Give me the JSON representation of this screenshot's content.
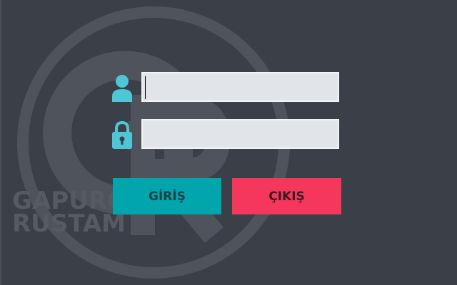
{
  "brand": {
    "line1": "GAPURO",
    "line2": "RUSTAM"
  },
  "login_form": {
    "username_value": "",
    "password_value": "",
    "login_label": "GİRİŞ",
    "exit_label": "ÇIKIŞ"
  },
  "icons": {
    "user": "user-icon",
    "password": "lock-icon"
  },
  "colors": {
    "background": "#3b3f47",
    "icon_accent": "#4fc6d6",
    "login_button": "#00a6ac",
    "exit_button": "#f4375a",
    "input_fill": "#e1e4e8"
  }
}
